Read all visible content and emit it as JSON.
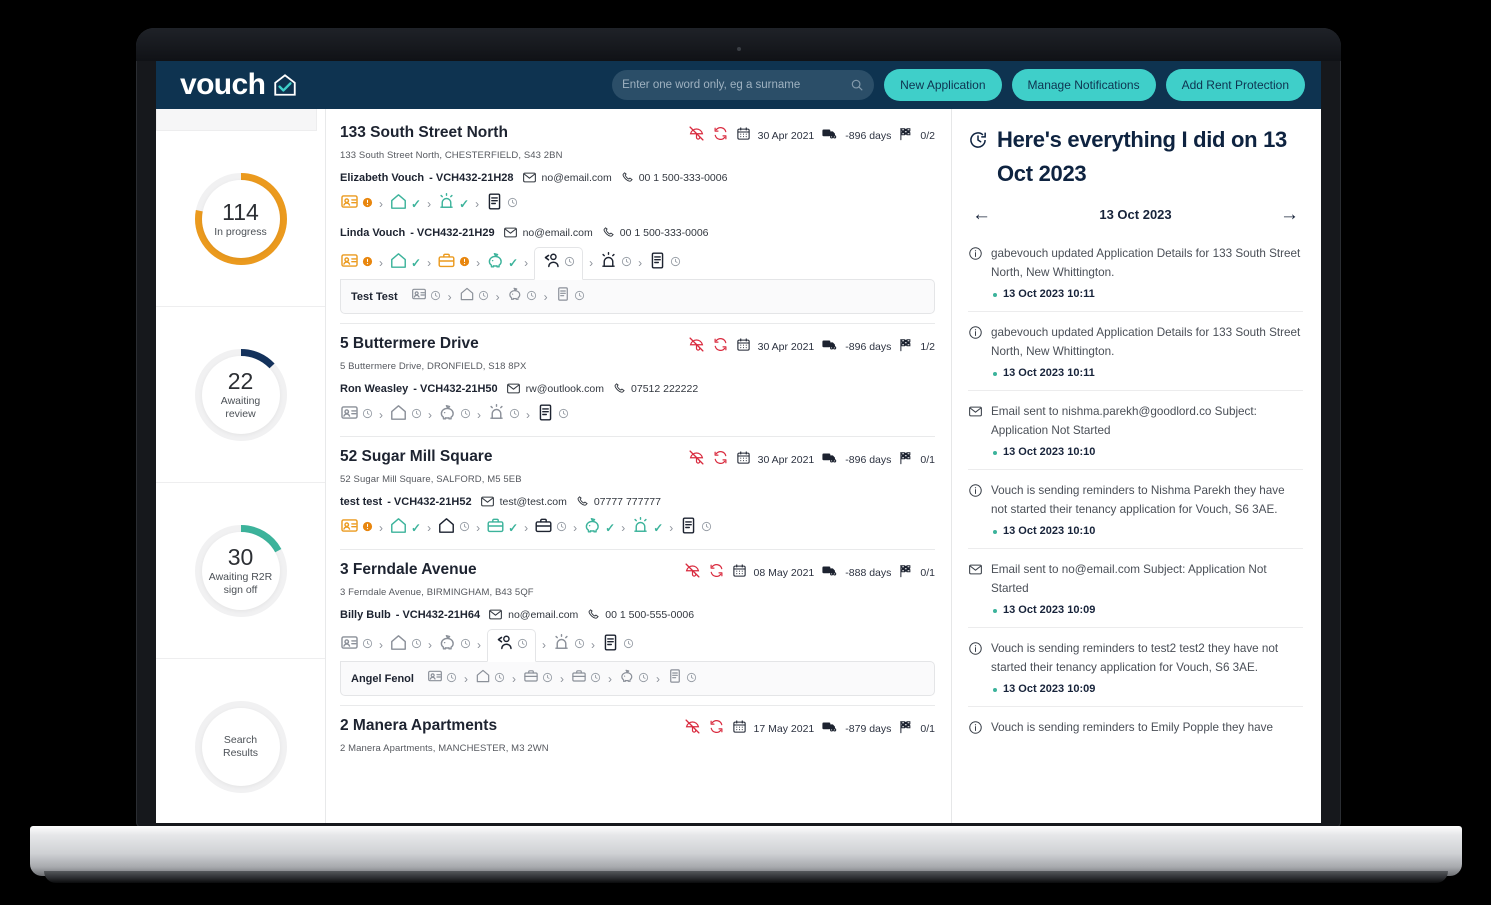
{
  "brand": {
    "logo_text": "vouch",
    "logo_icon": "house-check-icon",
    "navy": "#0e3350",
    "teal": "#3fcfc9",
    "orange": "#eb9a1e",
    "green": "#3cb39b",
    "red": "#d92b3f"
  },
  "header": {
    "search": {
      "placeholder": "Enter one word only, eg a surname",
      "value": "",
      "icon": "search-icon"
    },
    "buttons": [
      {
        "label": "New Application",
        "name": "new-application-button"
      },
      {
        "label": "Manage Notifications",
        "name": "manage-notifications-button"
      },
      {
        "label": "Add Rent Protection",
        "name": "add-rent-protection-button"
      }
    ]
  },
  "sidebar": {
    "stats": [
      {
        "value": "114",
        "label": "In progress",
        "color": "#eb9a1e",
        "percent": 78,
        "start": 0
      },
      {
        "value": "22",
        "label": "Awaiting review",
        "color": "#14325c",
        "percent": 13,
        "start": 0
      },
      {
        "value": "30",
        "label": "Awaiting R2R sign off",
        "color": "#3cb39b",
        "percent": 17,
        "start": 0
      },
      {
        "value": "",
        "label": "Search Results",
        "color": "#ffffff",
        "percent": 0,
        "start": 0
      }
    ]
  },
  "properties": [
    {
      "title": "133 South Street North",
      "address": "133 South Street North, CHESTERFIELD, S43 2BN",
      "date": "30 Apr 2021",
      "days": "-896 days",
      "flag": "0/2",
      "tenants": [
        {
          "name": "Elizabeth Vouch",
          "ref": "- VCH432-21H28",
          "email": "no@email.com",
          "phone": "00 1 500-333-0006",
          "steps": [
            {
              "icon": "id-card-icon",
              "state": "alert",
              "tone": "orange"
            },
            {
              "icon": "house-icon",
              "state": "done",
              "tone": "green"
            },
            {
              "icon": "siren-icon",
              "state": "done",
              "tone": "green"
            },
            {
              "icon": "document-icon",
              "state": "pending",
              "tone": "dark"
            }
          ]
        },
        {
          "name": "Linda Vouch",
          "ref": "- VCH432-21H29",
          "email": "no@email.com",
          "phone": "00 1 500-333-0006",
          "steps": [
            {
              "icon": "id-card-icon",
              "state": "alert",
              "tone": "orange"
            },
            {
              "icon": "house-icon",
              "state": "done",
              "tone": "green"
            },
            {
              "icon": "briefcase-icon",
              "state": "alert",
              "tone": "orange"
            },
            {
              "icon": "piggy-bank-icon",
              "state": "done",
              "tone": "green"
            },
            {
              "icon": "people-icon",
              "state": "pending",
              "tone": "dark",
              "active": true
            },
            {
              "icon": "siren-icon",
              "state": "pending",
              "tone": "dark"
            },
            {
              "icon": "document-icon",
              "state": "pending",
              "tone": "dark"
            }
          ],
          "sub": {
            "name": "Test Test",
            "steps": [
              {
                "icon": "id-card-icon",
                "state": "pending",
                "tone": "grey"
              },
              {
                "icon": "house-icon",
                "state": "pending",
                "tone": "grey"
              },
              {
                "icon": "piggy-bank-icon",
                "state": "pending",
                "tone": "grey"
              },
              {
                "icon": "document-icon",
                "state": "pending",
                "tone": "grey"
              }
            ]
          }
        }
      ]
    },
    {
      "title": "5 Buttermere Drive",
      "address": "5 Buttermere Drive, DRONFIELD, S18 8PX",
      "date": "30 Apr 2021",
      "days": "-896 days",
      "flag": "1/2",
      "tenants": [
        {
          "name": "Ron Weasley",
          "ref": "- VCH432-21H50",
          "email": "rw@outlook.com",
          "phone": "07512 222222",
          "steps": [
            {
              "icon": "id-card-icon",
              "state": "pending",
              "tone": "grey"
            },
            {
              "icon": "house-icon",
              "state": "pending",
              "tone": "grey"
            },
            {
              "icon": "piggy-bank-icon",
              "state": "pending",
              "tone": "grey"
            },
            {
              "icon": "siren-icon",
              "state": "pending",
              "tone": "grey"
            },
            {
              "icon": "document-icon",
              "state": "pending",
              "tone": "dark"
            }
          ]
        }
      ]
    },
    {
      "title": "52 Sugar Mill Square",
      "address": "52 Sugar Mill Square, SALFORD, M5 5EB",
      "date": "30 Apr 2021",
      "days": "-896 days",
      "flag": "0/1",
      "tenants": [
        {
          "name": "test test",
          "ref": "- VCH432-21H52",
          "email": "test@test.com",
          "phone": "07777 777777",
          "steps": [
            {
              "icon": "id-card-icon",
              "state": "alert",
              "tone": "orange"
            },
            {
              "icon": "house-icon",
              "state": "done",
              "tone": "green"
            },
            {
              "icon": "house-icon",
              "state": "pending",
              "tone": "dark"
            },
            {
              "icon": "briefcase-icon",
              "state": "done",
              "tone": "green"
            },
            {
              "icon": "briefcase-icon",
              "state": "pending",
              "tone": "dark"
            },
            {
              "icon": "piggy-bank-icon",
              "state": "done",
              "tone": "green"
            },
            {
              "icon": "siren-icon",
              "state": "done",
              "tone": "green"
            },
            {
              "icon": "document-icon",
              "state": "pending",
              "tone": "dark"
            }
          ]
        }
      ]
    },
    {
      "title": "3 Ferndale Avenue",
      "address": "3 Ferndale Avenue, BIRMINGHAM, B43 5QF",
      "date": "08 May 2021",
      "days": "-888 days",
      "flag": "0/1",
      "tenants": [
        {
          "name": "Billy Bulb",
          "ref": "- VCH432-21H64",
          "email": "no@email.com",
          "phone": "00 1 500-555-0006",
          "steps": [
            {
              "icon": "id-card-icon",
              "state": "pending",
              "tone": "grey"
            },
            {
              "icon": "house-icon",
              "state": "pending",
              "tone": "grey"
            },
            {
              "icon": "piggy-bank-icon",
              "state": "pending",
              "tone": "grey"
            },
            {
              "icon": "people-icon",
              "state": "pending",
              "tone": "dark",
              "active": true
            },
            {
              "icon": "siren-icon",
              "state": "pending",
              "tone": "grey"
            },
            {
              "icon": "document-icon",
              "state": "pending",
              "tone": "dark"
            }
          ],
          "sub": {
            "name": "Angel Fenol",
            "steps": [
              {
                "icon": "id-card-icon",
                "state": "pending",
                "tone": "grey"
              },
              {
                "icon": "house-icon",
                "state": "pending",
                "tone": "grey"
              },
              {
                "icon": "briefcase-icon",
                "state": "pending",
                "tone": "grey"
              },
              {
                "icon": "briefcase-icon",
                "state": "pending",
                "tone": "grey"
              },
              {
                "icon": "piggy-bank-icon",
                "state": "pending",
                "tone": "grey"
              },
              {
                "icon": "document-icon",
                "state": "pending",
                "tone": "grey"
              }
            ]
          }
        }
      ]
    },
    {
      "title": "2 Manera Apartments",
      "address": "2 Manera Apartments, MANCHESTER, M3 2WN",
      "date": "17 May 2021",
      "days": "-879 days",
      "flag": "0/1",
      "tenants": []
    }
  ],
  "activity": {
    "heading": "Here's everything I did on 13 Oct 2023",
    "heading_icon": "clock-icon",
    "prev_icon": "arrow-left-icon",
    "next_icon": "arrow-right-icon",
    "current_date": "13 Oct 2023",
    "items": [
      {
        "icon": "info-icon",
        "text": "gabevouch updated Application Details for 133 South Street North, New Whittington.",
        "time": "13 Oct 2023 10:11"
      },
      {
        "icon": "info-icon",
        "text": "gabevouch updated Application Details for 133 South Street North, New Whittington.",
        "time": "13 Oct 2023 10:11"
      },
      {
        "icon": "mail-icon",
        "text": "Email sent to nishma.parekh@goodlord.co Subject: Application Not Started",
        "time": "13 Oct 2023 10:10"
      },
      {
        "icon": "info-icon",
        "text": "Vouch is sending reminders to Nishma Parekh they have not started their tenancy application for Vouch, S6 3AE.",
        "time": "13 Oct 2023 10:10"
      },
      {
        "icon": "mail-icon",
        "text": "Email sent to no@email.com Subject: Application Not Started",
        "time": "13 Oct 2023 10:09"
      },
      {
        "icon": "info-icon",
        "text": "Vouch is sending reminders to test2 test2 they have not started their tenancy application for Vouch, S6 3AE.",
        "time": "13 Oct 2023 10:09"
      },
      {
        "icon": "info-icon",
        "text": "Vouch is sending reminders to Emily Popple they have",
        "time": ""
      }
    ]
  }
}
